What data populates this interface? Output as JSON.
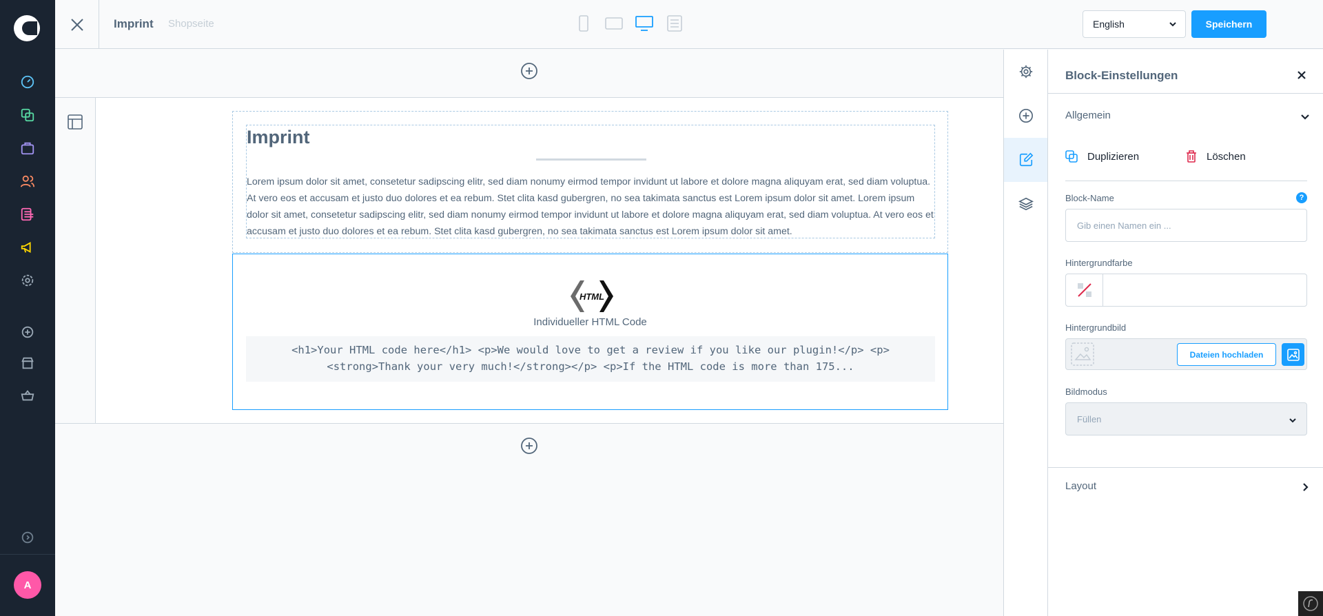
{
  "topbar": {
    "title": "Imprint",
    "subtitle": "Shopseite",
    "language": "English",
    "save_label": "Speichern"
  },
  "admin_nav": {
    "items": [
      "dashboard-icon",
      "catalog-icon",
      "orders-icon",
      "customers-icon",
      "content-icon",
      "marketing-icon",
      "settings-icon"
    ],
    "extra": [
      "extensions-icon",
      "sales-channel-icon",
      "shop-basket-icon"
    ],
    "avatar_initial": "A"
  },
  "stage": {
    "text_block": {
      "heading": "Imprint",
      "body": "Lorem ipsum dolor sit amet, consetetur sadipscing elitr, sed diam nonumy eirmod tempor invidunt ut labore et dolore magna aliquyam erat, sed diam voluptua. At vero eos et accusam et justo duo dolores et ea rebum. Stet clita kasd gubergren, no sea takimata sanctus est Lorem ipsum dolor sit amet. Lorem ipsum dolor sit amet, consetetur sadipscing elitr, sed diam nonumy eirmod tempor invidunt ut labore et dolore magna aliquyam erat, sed diam voluptua. At vero eos et accusam et justo duo dolores et ea rebum. Stet clita kasd gubergren, no sea takimata sanctus est Lorem ipsum dolor sit amet."
    },
    "html_block": {
      "logo_text": "HTML",
      "caption": "Individueller HTML Code",
      "code_preview": "<h1>Your HTML code here</h1> <p>We would love to get a review if you like our plugin!</p> <p><strong>Thank your very much!</strong></p> <p>If the HTML code is more than 175..."
    }
  },
  "panel": {
    "title": "Block-Einstellungen",
    "general_label": "Allgemein",
    "duplicate_label": "Duplizieren",
    "delete_label": "Löschen",
    "block_name_label": "Block-Name",
    "block_name_placeholder": "Gib einen Namen ein ...",
    "help_mark": "?",
    "bg_color_label": "Hintergrundfarbe",
    "bg_image_label": "Hintergrundbild",
    "upload_label": "Dateien hochladen",
    "image_mode_label": "Bildmodus",
    "image_mode_value": "Füllen",
    "layout_label": "Layout"
  },
  "colors": {
    "accent": "#189eff",
    "admin_bg": "#1a2431",
    "danger": "#de294c"
  }
}
